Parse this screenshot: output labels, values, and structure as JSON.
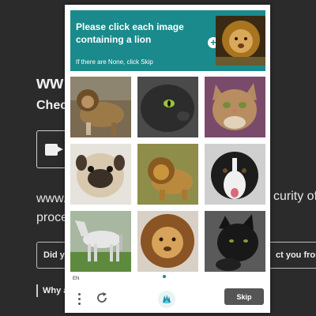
{
  "background": {
    "heading": "ww",
    "subheading": "Check",
    "text_left_line1": "www.",
    "text_left_line2": "proce",
    "text_right": "curity of",
    "box_left": "Did y",
    "box_right": "ct you from m",
    "why": "Why a"
  },
  "captcha": {
    "prompt": "Please click each image containing a lion",
    "hint": "If there are None, click Skip",
    "example_icon": "lion-example-image",
    "tiles": [
      {
        "label": "lion",
        "icon": "lion-image"
      },
      {
        "label": "black cat",
        "icon": "cat-image"
      },
      {
        "label": "tabby cat",
        "icon": "cat-image"
      },
      {
        "label": "pug dog",
        "icon": "dog-image"
      },
      {
        "label": "lion",
        "icon": "lion-image"
      },
      {
        "label": "border collie dog",
        "icon": "dog-image"
      },
      {
        "label": "white horse",
        "icon": "horse-image"
      },
      {
        "label": "lion",
        "icon": "lion-image"
      },
      {
        "label": "black cat",
        "icon": "cat-image"
      }
    ],
    "language": "EN",
    "skip_label": "Skip",
    "accent_color": "#1a8a8c"
  }
}
